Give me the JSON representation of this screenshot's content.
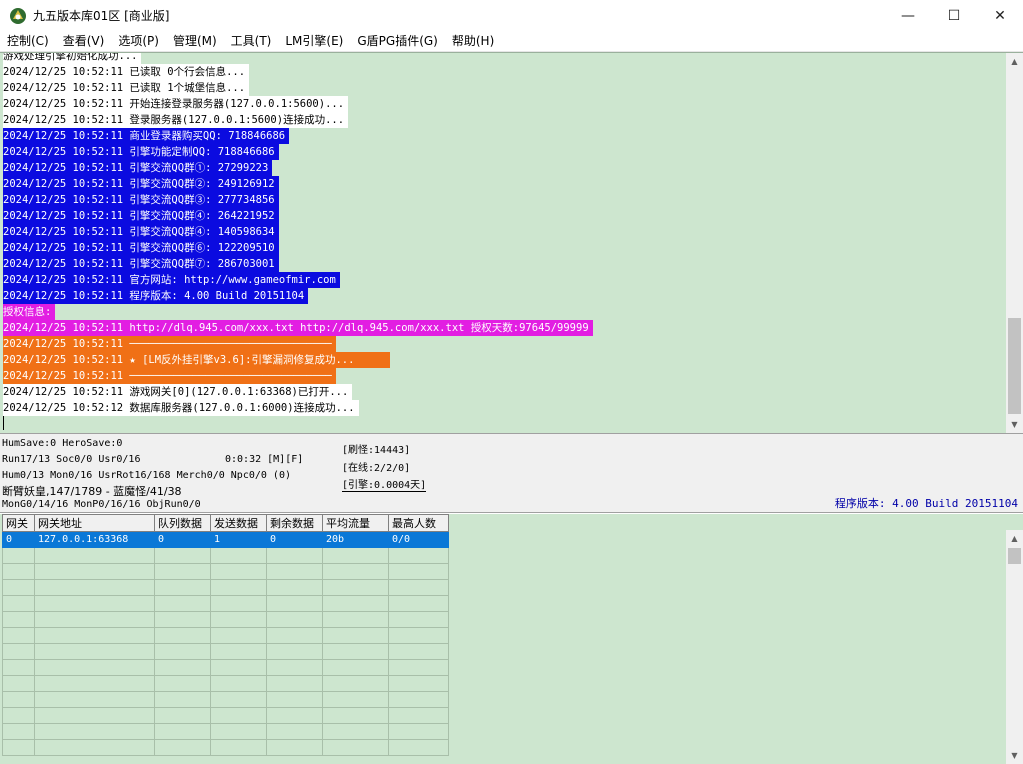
{
  "window": {
    "title": "九五版本库01区 [商业版]",
    "minimize_glyph": "—",
    "maximize_glyph": "☐",
    "close_glyph": "✕",
    "icon": "app-logo-icon"
  },
  "menu": [
    "控制(C)",
    "查看(V)",
    "选项(P)",
    "管理(M)",
    "工具(T)",
    "LM引擎(E)",
    "G盾PG插件(G)",
    "帮助(H)"
  ],
  "log": [
    {
      "text": "游戏处理引擎初始化成功...",
      "style": "white"
    },
    {
      "text": "2024/12/25 10:52:11 已读取 0个行会信息...",
      "style": "white"
    },
    {
      "text": "2024/12/25 10:52:11 已读取 1个城堡信息...",
      "style": "white"
    },
    {
      "text": "2024/12/25 10:52:11 开始连接登录服务器(127.0.0.1:5600)...",
      "style": "white"
    },
    {
      "text": "2024/12/25 10:52:11 登录服务器(127.0.0.1:5600)连接成功...",
      "style": "white"
    },
    {
      "text": "2024/12/25 10:52:11 商业登录器购买QQ: 718846686",
      "style": "blue"
    },
    {
      "text": "2024/12/25 10:52:11 引擎功能定制QQ: 718846686",
      "style": "blue"
    },
    {
      "text": "2024/12/25 10:52:11 引擎交流QQ群①: 27299223",
      "style": "blue"
    },
    {
      "text": "2024/12/25 10:52:11 引擎交流QQ群②: 249126912",
      "style": "blue"
    },
    {
      "text": "2024/12/25 10:52:11 引擎交流QQ群③: 277734856",
      "style": "blue"
    },
    {
      "text": "2024/12/25 10:52:11 引擎交流QQ群④: 264221952",
      "style": "blue"
    },
    {
      "text": "2024/12/25 10:52:11 引擎交流QQ群④: 140598634",
      "style": "blue"
    },
    {
      "text": "2024/12/25 10:52:11 引擎交流QQ群⑥: 122209510",
      "style": "blue"
    },
    {
      "text": "2024/12/25 10:52:11 引擎交流QQ群⑦: 286703001",
      "style": "blue"
    },
    {
      "text": "2024/12/25 10:52:11 官方网站: http://www.gameofmir.com",
      "style": "blue"
    },
    {
      "text": "2024/12/25 10:52:11 程序版本: 4.00 Build 20151104",
      "style": "blue"
    },
    {
      "text": "授权信息:",
      "style": "mag"
    },
    {
      "text": "2024/12/25 10:52:11 http://dlq.945.com/xxx.txt http://dlq.945.com/xxx.txt 授权天数:97645/99999",
      "style": "mag"
    },
    {
      "text": "2024/12/25 10:52:11 ────────────────────────────────",
      "style": "orange"
    },
    {
      "text": "2024/12/25 10:52:11 ★ [LM反外挂引擎v3.6]:引擎漏洞修复成功...     ",
      "style": "orange"
    },
    {
      "text": "2024/12/25 10:52:11 ────────────────────────────────",
      "style": "orange"
    },
    {
      "text": "2024/12/25 10:52:11 游戏网关[0](127.0.0.1:63368)已打开...",
      "style": "white"
    },
    {
      "text": "2024/12/25 10:52:12 数据库服务器(127.0.0.1:6000)连接成功...",
      "style": "white"
    }
  ],
  "status": {
    "line1": "HumSave:0 HeroSave:0",
    "line2": "Run17/13 Soc0/0 Usr0/16",
    "time": "0:0:32 [M][F]",
    "line3": "Hum0/13 Mon0/16 UsrRot16/168 Merch0/0 Npc0/0 (0)",
    "line4": "断臂妖皇,147/1789 - 蓝魔怪/41/38",
    "line5": "MonG0/14/16 MonP0/16/16 ObjRun0/0",
    "refresh": "[刷怪:14443]",
    "online": "[在线:2/2/0]",
    "engine": "[引擎:0.0004天]",
    "version": "程序版本: 4.00 Build 20151104"
  },
  "grid": {
    "headers": [
      "网关",
      "网关地址",
      "队列数据",
      "发送数据",
      "剩余数据",
      "平均流量",
      "最高人数"
    ],
    "rows": [
      [
        "0",
        "127.0.0.1:63368",
        "0",
        "1",
        "0",
        "20b",
        "0/0"
      ]
    ],
    "empty_rows": 13
  }
}
